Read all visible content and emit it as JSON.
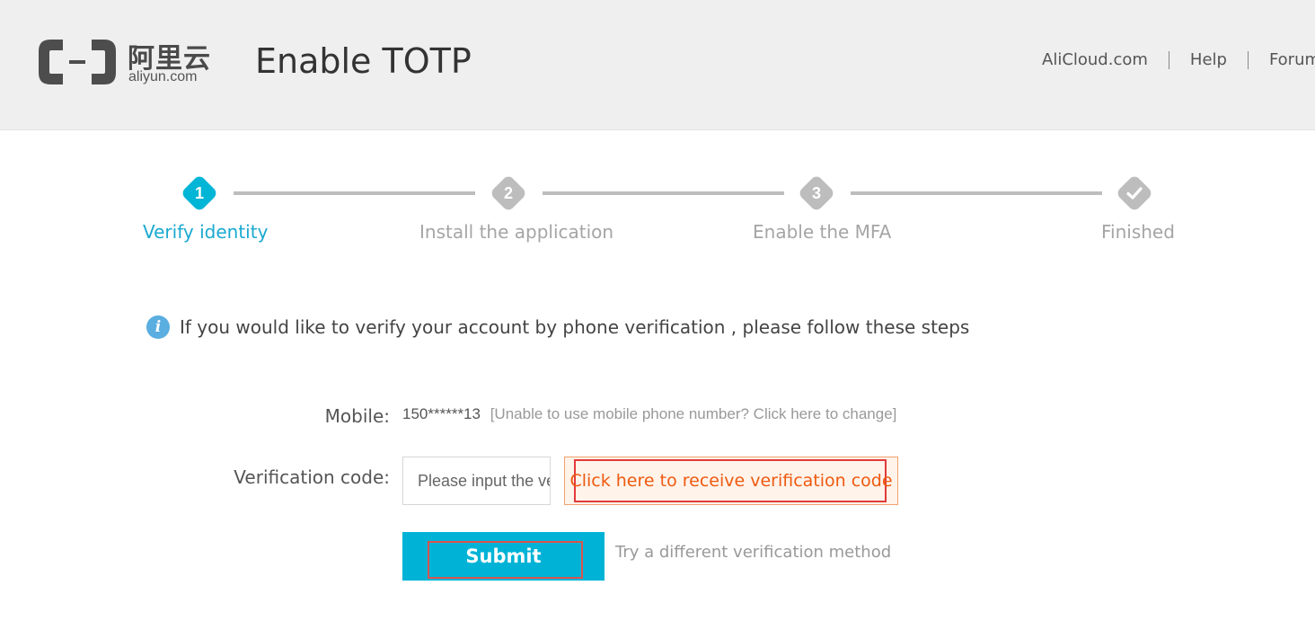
{
  "brand": {
    "logo_cn": "阿里云",
    "logo_en": "aliyun.com"
  },
  "header": {
    "title": "Enable TOTP",
    "nav": [
      "AliCloud.com",
      "Help",
      "Forum"
    ]
  },
  "steps": [
    {
      "number": "1",
      "label": "Verify identity",
      "active": true
    },
    {
      "number": "2",
      "label": "Install the application",
      "active": false
    },
    {
      "number": "3",
      "label": "Enable the MFA",
      "active": false
    },
    {
      "number": "",
      "label": "Finished",
      "active": false,
      "icon": "check-icon"
    }
  ],
  "info": {
    "icon": "info-icon",
    "text": "If you would like to verify your account by phone verification , please follow these steps"
  },
  "form": {
    "mobile_label": "Mobile:",
    "mobile_value": "150******13",
    "mobile_change_link": "[Unable to use mobile phone number? Click here to change]",
    "code_label": "Verification code:",
    "code_placeholder": "Please input the verification code",
    "code_value": "",
    "get_code_label": "Click here to receive verification code",
    "submit_label": "Submit",
    "alt_method_link": "Try a different verification method"
  },
  "colors": {
    "accent": "#00b3d6",
    "active_step_text": "#1aa9d0",
    "inactive_step": "#bdbdbd",
    "code_button_text": "#ee5a10",
    "code_button_bg": "#fff3ea",
    "highlight_outline": "#e23b3b",
    "header_bg": "#efefef"
  }
}
